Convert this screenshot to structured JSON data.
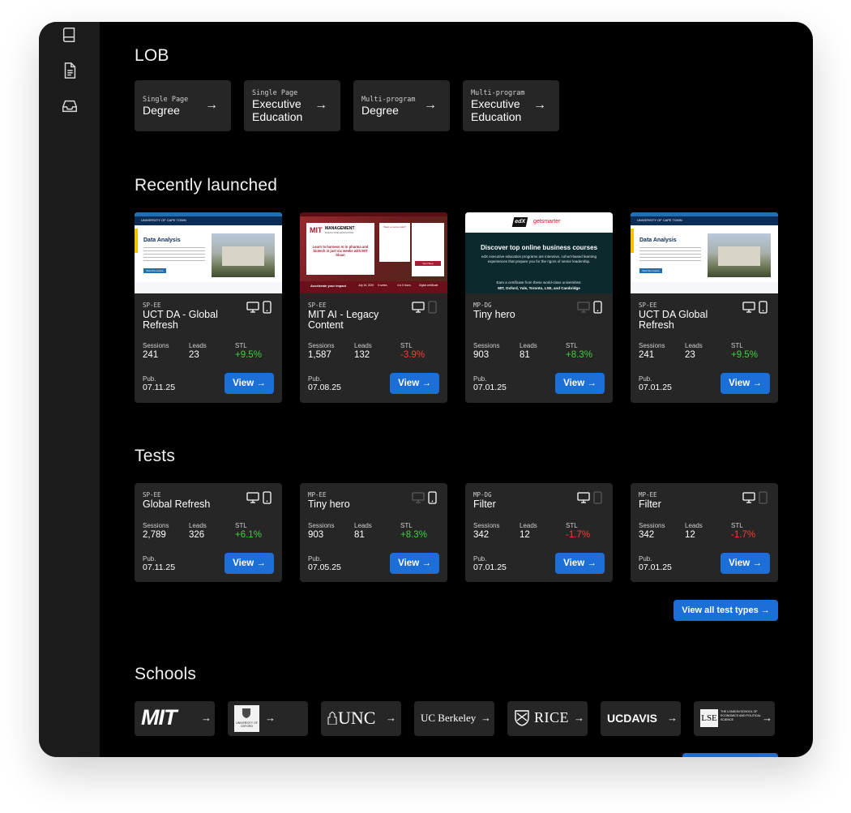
{
  "lob": {
    "heading": "LOB",
    "items": [
      {
        "small": "Single Page",
        "big1": "Degree",
        "big2": ""
      },
      {
        "small": "Single Page",
        "big1": "Executive",
        "big2": "Education"
      },
      {
        "small": "Multi-program",
        "big1": "Degree",
        "big2": ""
      },
      {
        "small": "Multi-program",
        "big1": "Executive",
        "big2": "Education"
      }
    ]
  },
  "recent": {
    "heading": "Recently launched",
    "cards": [
      {
        "tag": "SP-EE",
        "title": "UCT DA - Global Refresh",
        "sessions_label": "Sessions",
        "sessions": "241",
        "leads_label": "Leads",
        "leads": "23",
        "stl_label": "STL",
        "stl": "+9.5%",
        "pub_label": "Pub.",
        "pub": "07.11.25",
        "view": "View →",
        "thumb": {
          "brand": "UNIVERSITY OF CAPE TOWN",
          "heading": "Data Analysis",
          "cta": "Start the course"
        }
      },
      {
        "tag": "SP-EE",
        "title": "MIT AI - Legacy Content",
        "sessions_label": "Sessions",
        "sessions": "1,587",
        "leads_label": "Leads",
        "leads": "132",
        "stl_label": "STL",
        "stl": "-3.9%",
        "pub_label": "Pub.",
        "pub": "07.08.25",
        "view": "View →",
        "thumb": {
          "brand1": "MIT",
          "brand2": "MANAGEMENT",
          "brand3": "EXECUTIVE EDUCATION",
          "heading": "Learn to harness AI in pharma and biotech in just six weeks with MIT Sloan",
          "side": "Want a course start?",
          "impact": "Accelerate your impact",
          "date": "July 16, 2025",
          "weeks": "6 weeks",
          "hours": "4 to 6 hours",
          "cert": "Digital certificate",
          "submit": "Next Step"
        }
      },
      {
        "tag": "MP-DG",
        "title": "Tiny hero",
        "sessions_label": "Sessions",
        "sessions": "903",
        "leads_label": "Leads",
        "leads": "81",
        "stl_label": "STL",
        "stl": "+8.3%",
        "pub_label": "Pub.",
        "pub": "07.01.25",
        "view": "View →",
        "thumb": {
          "logo1": "edX",
          "logo2": "getsmarter",
          "heading": "Discover top online business courses",
          "body": "edX executive education programs are intensive, cohort-based learning experiences that prepare you for the rigors of senior leadership.",
          "earn": "Earn a certificate from these world-class universities:",
          "unis": "MIT, Oxford, Yale, Toronto, LSE, and Cambridge"
        }
      },
      {
        "tag": "SP-EE",
        "title": "UCT DA Global Refresh",
        "sessions_label": "Sessions",
        "sessions": "241",
        "leads_label": "Leads",
        "leads": "23",
        "stl_label": "STL",
        "stl": "+9.5%",
        "pub_label": "Pub.",
        "pub": "07.01.25",
        "view": "View →",
        "thumb": {
          "brand": "UNIVERSITY OF CAPE TOWN",
          "heading": "Data Analysis",
          "cta": "Start the course"
        }
      }
    ]
  },
  "tests": {
    "heading": "Tests",
    "cards": [
      {
        "tag": "SP-EE",
        "title": "Global Refresh",
        "sessions_label": "Sessions",
        "sessions": "2,789",
        "leads_label": "Leads",
        "leads": "326",
        "stl_label": "STL",
        "stl": "+6.1%",
        "pub_label": "Pub.",
        "pub": "07.11.25",
        "view": "View →"
      },
      {
        "tag": "MP-EE",
        "title": "Tiny hero",
        "sessions_label": "Sessions",
        "sessions": "903",
        "leads_label": "Leads",
        "leads": "81",
        "stl_label": "STL",
        "stl": "+8.3%",
        "pub_label": "Pub.",
        "pub": "07.05.25",
        "view": "View →"
      },
      {
        "tag": "MP-DG",
        "title": "Filter",
        "sessions_label": "Sessions",
        "sessions": "342",
        "leads_label": "Leads",
        "leads": "12",
        "stl_label": "STL",
        "stl": "-1.7%",
        "pub_label": "Pub.",
        "pub": "07.01.25",
        "view": "View →"
      },
      {
        "tag": "MP-EE",
        "title": "Filter",
        "sessions_label": "Sessions",
        "sessions": "342",
        "leads_label": "Leads",
        "leads": "12",
        "stl_label": "STL",
        "stl": "-1.7%",
        "pub_label": "Pub.",
        "pub": "07.01.25",
        "view": "View →"
      }
    ],
    "view_all": "View all test types →"
  },
  "schools": {
    "heading": "Schools",
    "items": [
      "MIT",
      "UNIVERSITY OF OXFORD",
      "UNC",
      "UC Berkeley",
      "RICE",
      "UCDAVIS",
      "THE LONDON SCHOOL OF ECONOMICS AND POLITICAL SCIENCE"
    ],
    "lse_mark": "LSE",
    "arrow": "→"
  },
  "colors": {
    "accent": "#1d6fd8",
    "positive": "#3ed13e",
    "negative": "#ff3b30",
    "card": "#262626"
  }
}
